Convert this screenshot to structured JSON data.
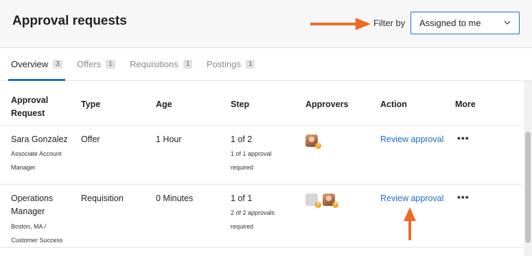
{
  "header": {
    "title": "Approval requests",
    "filter_label": "Filter by",
    "filter_value": "Assigned to me"
  },
  "tabs": [
    {
      "label": "Overview",
      "count": "3"
    },
    {
      "label": "Offers",
      "count": "1"
    },
    {
      "label": "Requisitions",
      "count": "1"
    },
    {
      "label": "Postings",
      "count": "1"
    }
  ],
  "columns": {
    "approval_request": "Approval Request",
    "type": "Type",
    "age": "Age",
    "step": "Step",
    "approvers": "Approvers",
    "action": "Action",
    "more": "More"
  },
  "rows": [
    {
      "name": "Sara Gonzalez",
      "subtitle": "Associate Account Manager",
      "type": "Offer",
      "age": "1 Hour",
      "step": "1 of 2",
      "step_detail": "1 of 1 approval required",
      "action": "Review approval",
      "more": "•••"
    },
    {
      "name": "Operations Manager",
      "subtitle": "Boston, MA / Customer Success",
      "type": "Requisition",
      "age": "0 Minutes",
      "step": "1 of 1",
      "step_detail": "2 of 2 approvals required",
      "action": "Review approval",
      "more": "•••"
    }
  ],
  "badge_text": "?",
  "colors": {
    "accent": "#1b6fc4",
    "annotation_arrow": "#f26a22",
    "pending_badge": "#f5a623"
  }
}
